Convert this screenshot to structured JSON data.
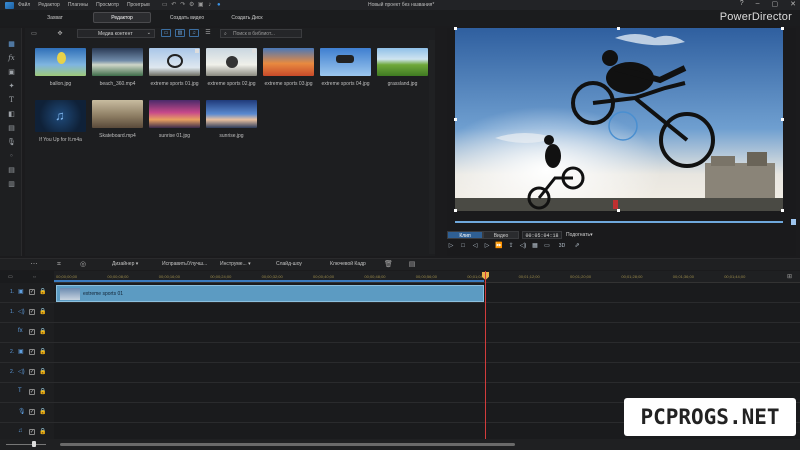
{
  "menu": {
    "items": [
      "Файл",
      "Редактор",
      "Плагины",
      "Просмотр",
      "Проигрыв"
    ],
    "project_title": "Новый проект без названия*"
  },
  "modes": {
    "capture": "Захват",
    "editor": "Редактор",
    "create_disc": "Создать видео",
    "create_dvd": "Создать Диск",
    "active": "Редактор"
  },
  "brand": "PowerDirector",
  "library": {
    "dropdown_value": "Медиа контент",
    "search_placeholder": "Поиск в библиот...",
    "items": [
      {
        "name": "ballon.jpg"
      },
      {
        "name": "beach_360.mp4"
      },
      {
        "name": "extreme sports 01.jpg"
      },
      {
        "name": "extreme sports 02.jpg"
      },
      {
        "name": "extreme sports 03.jpg"
      },
      {
        "name": "extreme sports 04.jpg"
      },
      {
        "name": "grassland.jpg"
      },
      {
        "name": "If You Up for It.m4a"
      },
      {
        "name": "Skateboard.mp4"
      },
      {
        "name": "sunrise 01.jpg"
      },
      {
        "name": "sunrise.jpg"
      }
    ]
  },
  "preview": {
    "tab_clip": "Клип",
    "tab_movie": "Видео",
    "timecode": "00:05:04:18",
    "fit": "Подогнать",
    "mode_3d": "3D"
  },
  "edit_toolbar": {
    "designer": "Дизайнер",
    "fix": "Исправить/Улучш...",
    "tools": "Инструме...",
    "slideshow": "Слайд-шоу",
    "keyframe": "Ключевой Кадр"
  },
  "timeline": {
    "ticks": [
      "00;00;00;00",
      "00;00;08;00",
      "00;00;16;00",
      "00;00;24;00",
      "00;00;32;00",
      "00;00;40;00",
      "00;00;48;00",
      "00;00;56;00",
      "00;01;04;00",
      "00;01;12;00",
      "00;01;20;00",
      "00;01;28;00",
      "00;01;36;00",
      "00;01;44;00"
    ],
    "tracks": [
      {
        "num": "1.",
        "icon": "▣"
      },
      {
        "num": "1.",
        "icon": "◁)"
      },
      {
        "num": "",
        "icon": "fx"
      },
      {
        "num": "2.",
        "icon": "▣"
      },
      {
        "num": "2.",
        "icon": "◁)"
      },
      {
        "num": "",
        "icon": "T"
      },
      {
        "num": "",
        "icon": "🎙"
      },
      {
        "num": "",
        "icon": "♫"
      }
    ],
    "clip_label": "extreme sports 01"
  },
  "watermark": "PCPROGS.NET",
  "colors": {
    "accent": "#3b93e6",
    "clip": "#5c9bc2",
    "playhead": "#d23c3c"
  }
}
